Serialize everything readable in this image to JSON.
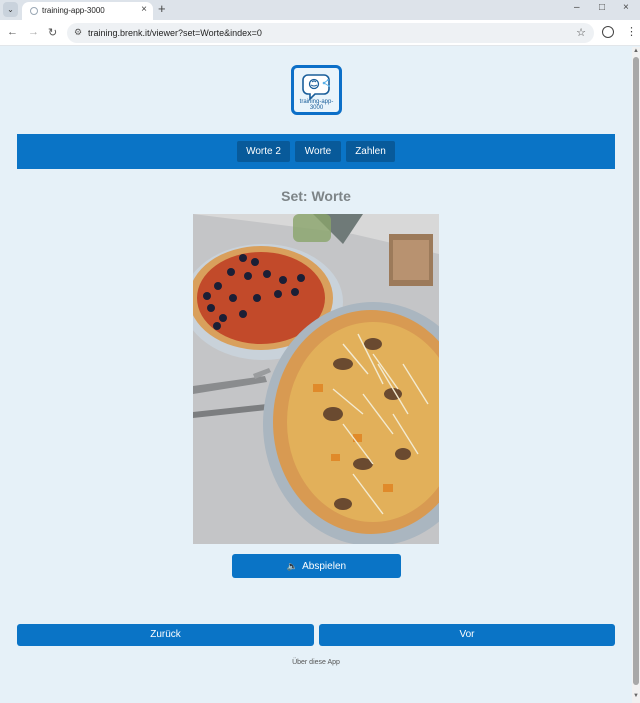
{
  "browser": {
    "tab_title": "training-app-3000",
    "url": "training.brenk.it/viewer?set=Worte&index=0"
  },
  "logo": {
    "text_line1": "training-app-",
    "text_line2": "3000"
  },
  "nav": {
    "items": [
      {
        "label": "Worte 2"
      },
      {
        "label": "Worte"
      },
      {
        "label": "Zahlen"
      }
    ]
  },
  "set": {
    "title": "Set: Worte"
  },
  "image": {
    "subject": "two pizzas on plates"
  },
  "player": {
    "play_label": "Abspielen"
  },
  "pager": {
    "prev_label": "Zurück",
    "next_label": "Vor"
  },
  "footer": {
    "about_label": "Über diese App"
  },
  "colors": {
    "accent": "#0a74c6",
    "nav_button": "#085a9a",
    "page_bg": "#e6f1f8"
  },
  "icons": {
    "play": "speaker-icon",
    "back": "arrow-left-icon",
    "forward": "arrow-right-icon",
    "reload": "reload-icon",
    "bookmark": "star-icon"
  }
}
